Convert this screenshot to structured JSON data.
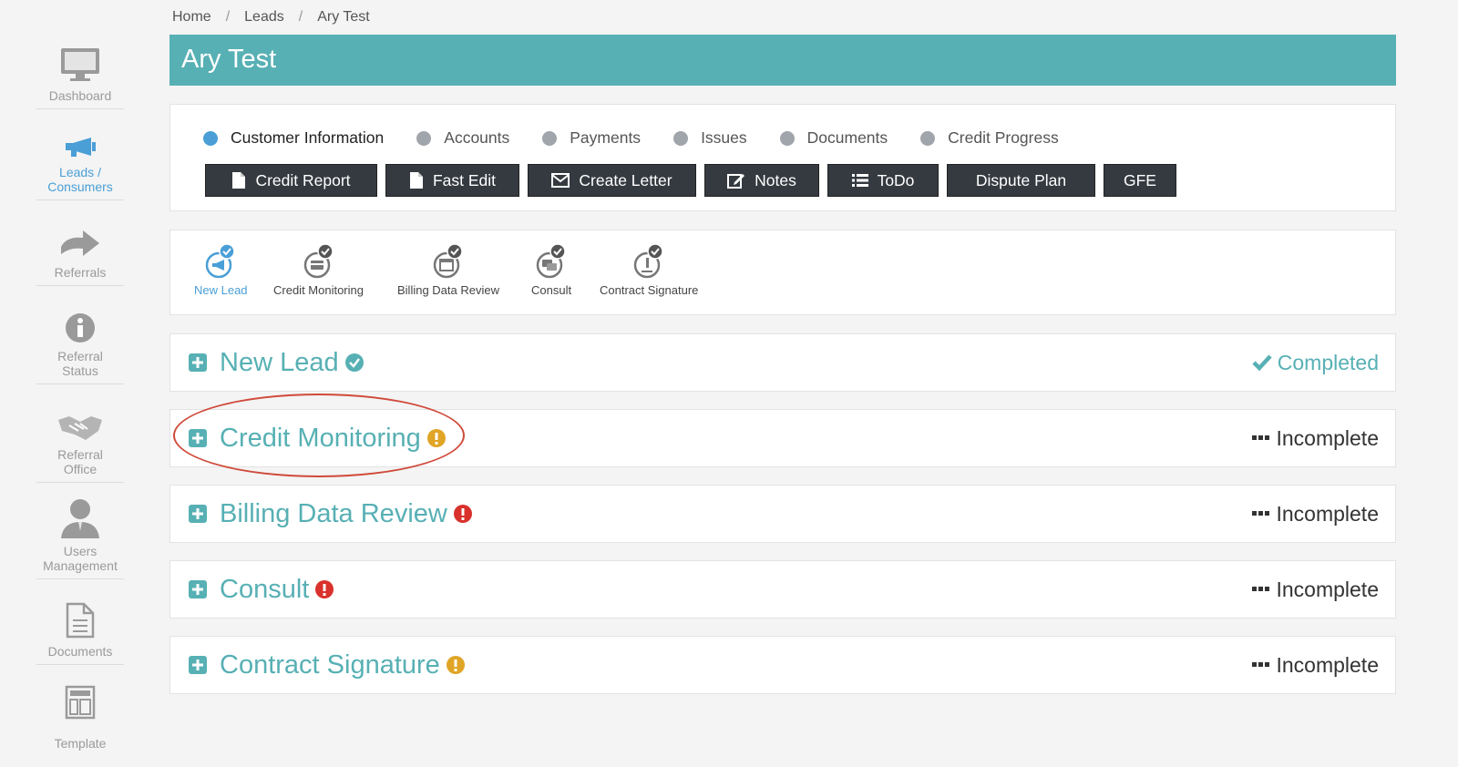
{
  "sidebar": {
    "items": [
      {
        "label": "Dashboard",
        "icon": "monitor-icon"
      },
      {
        "label": "Leads / Consumers",
        "icon": "megaphone-icon"
      },
      {
        "label": "Referrals",
        "icon": "arrow-right-icon"
      },
      {
        "label": "Referral Status",
        "icon": "info-icon"
      },
      {
        "label": "Referral Office",
        "icon": "handshake-icon"
      },
      {
        "label": "Users Management",
        "icon": "user-icon"
      },
      {
        "label": "Documents",
        "icon": "document-icon"
      },
      {
        "label": "Template",
        "icon": "template-icon"
      }
    ]
  },
  "breadcrumb": {
    "home": "Home",
    "leads": "Leads",
    "current": "Ary Test",
    "separator": "/"
  },
  "header": {
    "title": "Ary Test"
  },
  "tabs": [
    {
      "label": "Customer Information"
    },
    {
      "label": "Accounts"
    },
    {
      "label": "Payments"
    },
    {
      "label": "Issues"
    },
    {
      "label": "Documents"
    },
    {
      "label": "Credit Progress"
    }
  ],
  "buttons": [
    {
      "label": "Credit Report",
      "icon": "file-icon"
    },
    {
      "label": "Fast Edit",
      "icon": "file-icon"
    },
    {
      "label": "Create Letter",
      "icon": "envelope-icon"
    },
    {
      "label": "Notes",
      "icon": "edit-icon"
    },
    {
      "label": "ToDo",
      "icon": "list-icon"
    },
    {
      "label": "Dispute Plan",
      "icon": ""
    },
    {
      "label": "GFE",
      "icon": ""
    }
  ],
  "steps": [
    {
      "label": "New Lead"
    },
    {
      "label": "Credit Monitoring"
    },
    {
      "label": "Billing Data Review"
    },
    {
      "label": "Consult"
    },
    {
      "label": "Contract Signature"
    }
  ],
  "sections": [
    {
      "title": "New Lead",
      "flag": "check",
      "status": "Completed"
    },
    {
      "title": "Credit Monitoring",
      "flag": "warning",
      "status": "Incomplete"
    },
    {
      "title": "Billing Data Review",
      "flag": "error",
      "status": "Incomplete"
    },
    {
      "title": "Consult",
      "flag": "error",
      "status": "Incomplete"
    },
    {
      "title": "Contract Signature",
      "flag": "warning",
      "status": "Incomplete"
    }
  ],
  "colors": {
    "accent": "#57b0b4",
    "active": "#4a9fd6",
    "warning": "#e0a526",
    "error": "#d9312c",
    "button": "#353a40",
    "annotation": "#d04a3a"
  }
}
